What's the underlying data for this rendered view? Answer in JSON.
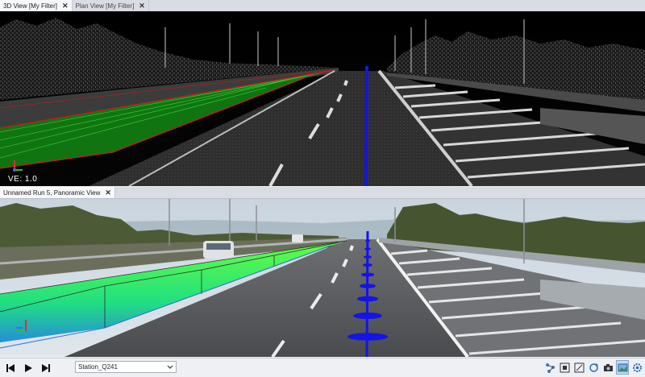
{
  "tabs_top": [
    {
      "label": "3D View [My Filter]",
      "active": true
    },
    {
      "label": "Plan View [My Filter]",
      "active": false
    }
  ],
  "tab_close_glyph": "✕",
  "view3d": {
    "ve_label": "VE: 1.0"
  },
  "tabs_bottom": [
    {
      "label": "Unnamed Run 5, Panoramic View",
      "active": true
    }
  ],
  "toolbar": {
    "station_value": "Station_Q241",
    "playback": [
      "skip-to-start-icon",
      "play-icon",
      "skip-to-end-icon"
    ],
    "tools": [
      "tree-network-icon",
      "fit-view-icon",
      "expand-icon",
      "refresh-icon",
      "camera-icon",
      "image-layer-icon",
      "settings-gear-icon"
    ]
  },
  "colors": {
    "profile_line": "#1414e6",
    "surface_green": "#22c522",
    "bound_red": "#d01818",
    "tab_active": "#f7f8fa"
  }
}
